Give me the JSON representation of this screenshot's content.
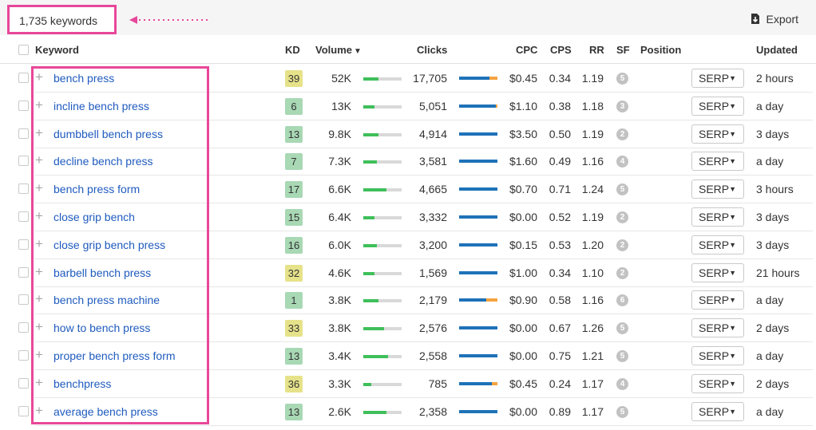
{
  "toolbar": {
    "keyword_count": "1,735 keywords",
    "export_label": "Export",
    "export_icon": "download-icon"
  },
  "columns": {
    "keyword": "Keyword",
    "kd": "KD",
    "volume": "Volume",
    "sort_indicator": "▼",
    "clicks": "Clicks",
    "cpc": "CPC",
    "cps": "CPS",
    "rr": "RR",
    "sf": "SF",
    "position": "Position",
    "updated": "Updated"
  },
  "colors": {
    "highlight": "#e8479a",
    "kd_green": "#a8d8b4",
    "kd_yellow": "#e6e28a",
    "volume_bar": "#3fbf5a",
    "clicks_organic": "#1e72b8",
    "clicks_paid": "#f5a440",
    "link": "#1f5bbf"
  },
  "rows": [
    {
      "keyword": "bench press",
      "kd": "39",
      "kd_level": "yellow",
      "volume": "52K",
      "vol_fill": 0.4,
      "clicks": "17,705",
      "clk_organic": 0.8,
      "clk_paid": 0.2,
      "cpc": "$0.45",
      "cps": "0.34",
      "rr": "1.19",
      "sf": "5",
      "serp": "SERP",
      "updated": "2 hours"
    },
    {
      "keyword": "incline bench press",
      "kd": "6",
      "kd_level": "green",
      "volume": "13K",
      "vol_fill": 0.3,
      "clicks": "5,051",
      "clk_organic": 0.96,
      "clk_paid": 0.04,
      "cpc": "$1.10",
      "cps": "0.38",
      "rr": "1.18",
      "sf": "3",
      "serp": "SERP",
      "updated": "a day"
    },
    {
      "keyword": "dumbbell bench press",
      "kd": "13",
      "kd_level": "green",
      "volume": "9.8K",
      "vol_fill": 0.4,
      "clicks": "4,914",
      "clk_organic": 1.0,
      "clk_paid": 0,
      "cpc": "$3.50",
      "cps": "0.50",
      "rr": "1.19",
      "sf": "2",
      "serp": "SERP",
      "updated": "3 days"
    },
    {
      "keyword": "decline bench press",
      "kd": "7",
      "kd_level": "green",
      "volume": "7.3K",
      "vol_fill": 0.35,
      "clicks": "3,581",
      "clk_organic": 1.0,
      "clk_paid": 0,
      "cpc": "$1.60",
      "cps": "0.49",
      "rr": "1.16",
      "sf": "4",
      "serp": "SERP",
      "updated": "a day"
    },
    {
      "keyword": "bench press form",
      "kd": "17",
      "kd_level": "green",
      "volume": "6.6K",
      "vol_fill": 0.6,
      "clicks": "4,665",
      "clk_organic": 1.0,
      "clk_paid": 0,
      "cpc": "$0.70",
      "cps": "0.71",
      "rr": "1.24",
      "sf": "5",
      "serp": "SERP",
      "updated": "3 hours"
    },
    {
      "keyword": "close grip bench",
      "kd": "15",
      "kd_level": "green",
      "volume": "6.4K",
      "vol_fill": 0.3,
      "clicks": "3,332",
      "clk_organic": 1.0,
      "clk_paid": 0,
      "cpc": "$0.00",
      "cps": "0.52",
      "rr": "1.19",
      "sf": "2",
      "serp": "SERP",
      "updated": "3 days"
    },
    {
      "keyword": "close grip bench press",
      "kd": "16",
      "kd_level": "green",
      "volume": "6.0K",
      "vol_fill": 0.35,
      "clicks": "3,200",
      "clk_organic": 1.0,
      "clk_paid": 0,
      "cpc": "$0.15",
      "cps": "0.53",
      "rr": "1.20",
      "sf": "2",
      "serp": "SERP",
      "updated": "3 days"
    },
    {
      "keyword": "barbell bench press",
      "kd": "32",
      "kd_level": "yellow",
      "volume": "4.6K",
      "vol_fill": 0.3,
      "clicks": "1,569",
      "clk_organic": 1.0,
      "clk_paid": 0,
      "cpc": "$1.00",
      "cps": "0.34",
      "rr": "1.10",
      "sf": "2",
      "serp": "SERP",
      "updated": "21 hours"
    },
    {
      "keyword": "bench press machine",
      "kd": "1",
      "kd_level": "green",
      "volume": "3.8K",
      "vol_fill": 0.4,
      "clicks": "2,179",
      "clk_organic": 0.7,
      "clk_paid": 0.3,
      "cpc": "$0.90",
      "cps": "0.58",
      "rr": "1.16",
      "sf": "6",
      "serp": "SERP",
      "updated": "a day"
    },
    {
      "keyword": "how to bench press",
      "kd": "33",
      "kd_level": "yellow",
      "volume": "3.8K",
      "vol_fill": 0.55,
      "clicks": "2,576",
      "clk_organic": 1.0,
      "clk_paid": 0,
      "cpc": "$0.00",
      "cps": "0.67",
      "rr": "1.26",
      "sf": "5",
      "serp": "SERP",
      "updated": "2 days"
    },
    {
      "keyword": "proper bench press form",
      "kd": "13",
      "kd_level": "green",
      "volume": "3.4K",
      "vol_fill": 0.65,
      "clicks": "2,558",
      "clk_organic": 1.0,
      "clk_paid": 0,
      "cpc": "$0.00",
      "cps": "0.75",
      "rr": "1.21",
      "sf": "5",
      "serp": "SERP",
      "updated": "a day"
    },
    {
      "keyword": "benchpress",
      "kd": "36",
      "kd_level": "yellow",
      "volume": "3.3K",
      "vol_fill": 0.2,
      "clicks": "785",
      "clk_organic": 0.85,
      "clk_paid": 0.15,
      "cpc": "$0.45",
      "cps": "0.24",
      "rr": "1.17",
      "sf": "4",
      "serp": "SERP",
      "updated": "2 days"
    },
    {
      "keyword": "average bench press",
      "kd": "13",
      "kd_level": "green",
      "volume": "2.6K",
      "vol_fill": 0.6,
      "clicks": "2,358",
      "clk_organic": 1.0,
      "clk_paid": 0,
      "cpc": "$0.00",
      "cps": "0.89",
      "rr": "1.17",
      "sf": "5",
      "serp": "SERP",
      "updated": "a day"
    }
  ]
}
